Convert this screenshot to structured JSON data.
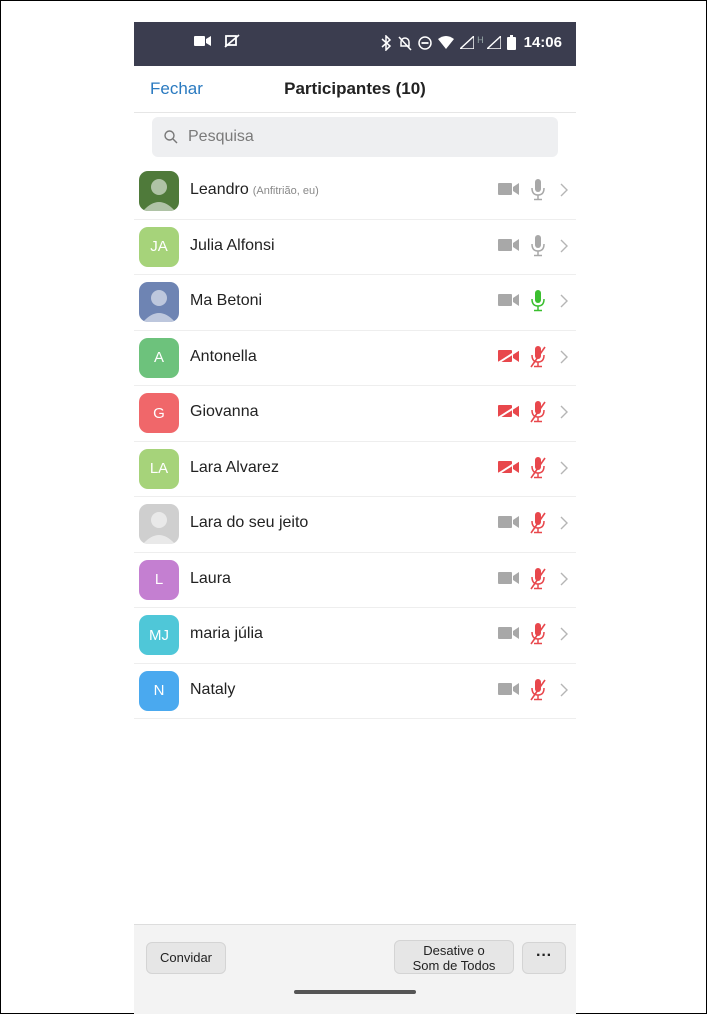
{
  "status_bar": {
    "time": "14:06"
  },
  "header": {
    "close_label": "Fechar",
    "title": "Participantes (10)"
  },
  "search": {
    "placeholder": "Pesquisa"
  },
  "participants": [
    {
      "name": "Leandro",
      "role": "(Anfitrião, eu)",
      "initials": "",
      "avatar_color": "#4f7a3a",
      "video": "off",
      "audio": "idle"
    },
    {
      "name": "Julia Alfonsi",
      "role": "",
      "initials": "JA",
      "avatar_color": "#a6d37a",
      "video": "off",
      "audio": "idle"
    },
    {
      "name": "Ma Betoni",
      "role": "",
      "initials": "",
      "avatar_color": "#6e84b3",
      "video": "off",
      "audio": "speaking"
    },
    {
      "name": "Antonella",
      "role": "",
      "initials": "A",
      "avatar_color": "#6dc27c",
      "video": "blocked",
      "audio": "muted"
    },
    {
      "name": "Giovanna",
      "role": "",
      "initials": "G",
      "avatar_color": "#f0676a",
      "video": "blocked",
      "audio": "muted"
    },
    {
      "name": "Lara Alvarez",
      "role": "",
      "initials": "LA",
      "avatar_color": "#a6d37a",
      "video": "blocked",
      "audio": "muted"
    },
    {
      "name": "Lara do seu jeito",
      "role": "",
      "initials": "",
      "avatar_color": "#cfcfcf",
      "video": "off",
      "audio": "muted"
    },
    {
      "name": "Laura",
      "role": "",
      "initials": "L",
      "avatar_color": "#c47fd1",
      "video": "off",
      "audio": "muted"
    },
    {
      "name": "maria júlia",
      "role": "",
      "initials": "MJ",
      "avatar_color": "#4fc7d8",
      "video": "off",
      "audio": "muted"
    },
    {
      "name": "Nataly",
      "role": "",
      "initials": "N",
      "avatar_color": "#4aa9ef",
      "video": "off",
      "audio": "muted"
    }
  ],
  "bottom": {
    "invite_label": "Convidar",
    "mute_all_line1": "Desative o",
    "mute_all_line2": "Som de Todos",
    "more_label": "···"
  },
  "colors": {
    "accent": "#2a7ac0",
    "muted_red": "#e8474c",
    "speaking_green": "#3bbf2f",
    "icon_gray": "#a8a8a8"
  }
}
